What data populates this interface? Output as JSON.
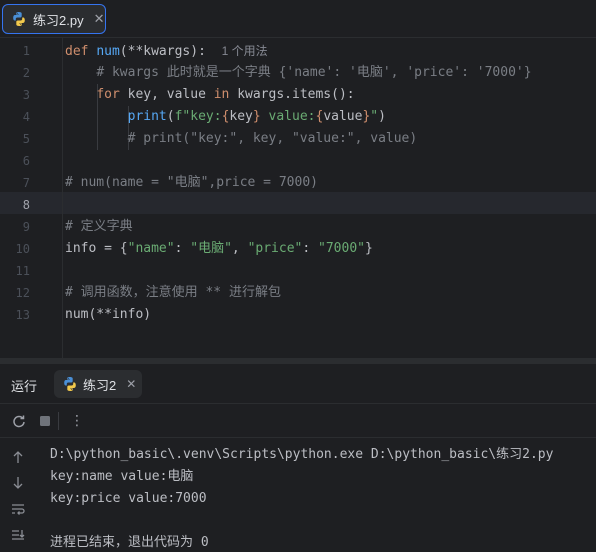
{
  "editor_tab": {
    "label": "练习2.py",
    "close": "✕",
    "icon": "python-icon"
  },
  "code": {
    "line_numbers": [
      "1",
      "2",
      "3",
      "4",
      "5",
      "6",
      "7",
      "8",
      "9",
      "10",
      "11",
      "12",
      "13"
    ],
    "current_line": "8",
    "l1": {
      "def": "def",
      "name": "num",
      "params_open": "(**",
      "kwargs": "kwargs",
      "params_close": "):",
      "usages_hint": "1 个用法"
    },
    "l2": {
      "comment": "# kwargs 此时就是一个字典 {'name': '电脑', 'price': '7000'}"
    },
    "l3": {
      "for": "for",
      "vars": " key, value ",
      "in": "in",
      "iter": " kwargs.items():"
    },
    "l4": {
      "print": "print",
      "open": "(",
      "fstr_a": "f\"key:",
      "b1": "{",
      "key": "key",
      "b2": "}",
      "fstr_b": " value:",
      "b3": "{",
      "value": "value",
      "b4": "}",
      "fstr_c": "\"",
      "close": ")"
    },
    "l5": {
      "comment": "# print(\"key:\", key, \"value:\", value)"
    },
    "l7": {
      "comment": "# num(name = \"电脑\",price = 7000)"
    },
    "l9": {
      "comment": "# 定义字典"
    },
    "l10": {
      "lhs": "info = {",
      "k1": "\"name\"",
      "c1": ": ",
      "v1": "\"电脑\"",
      "sep": ", ",
      "k2": "\"price\"",
      "c2": ": ",
      "v2": "\"7000\"",
      "end": "}"
    },
    "l12": {
      "comment": "# 调用函数，注意使用 ** 进行解包"
    },
    "l13": {
      "call": "num(**info)"
    }
  },
  "run_panel": {
    "title": "运行",
    "tab_label": "练习2",
    "tab_close": "✕",
    "toolbar": {
      "rerun_icon": "rerun-icon",
      "stop_icon": "stop-icon",
      "more_icon": "more-vertical-icon",
      "more": "⋮"
    },
    "side": [
      "arrow-up-icon",
      "arrow-down-icon",
      "soft-wrap-icon",
      "scroll-to-end-icon"
    ],
    "output": [
      "D:\\python_basic\\.venv\\Scripts\\python.exe D:\\python_basic\\练习2.py",
      "key:name value:电脑",
      "key:price value:7000",
      "",
      "进程已结束，退出代码为 0"
    ]
  },
  "colors": {
    "background": "#1e1f22",
    "keyword": "#cf8e6d",
    "function": "#56a8f5",
    "comment": "#7a7e85",
    "string": "#6aab73",
    "accent": "#3574f0"
  }
}
